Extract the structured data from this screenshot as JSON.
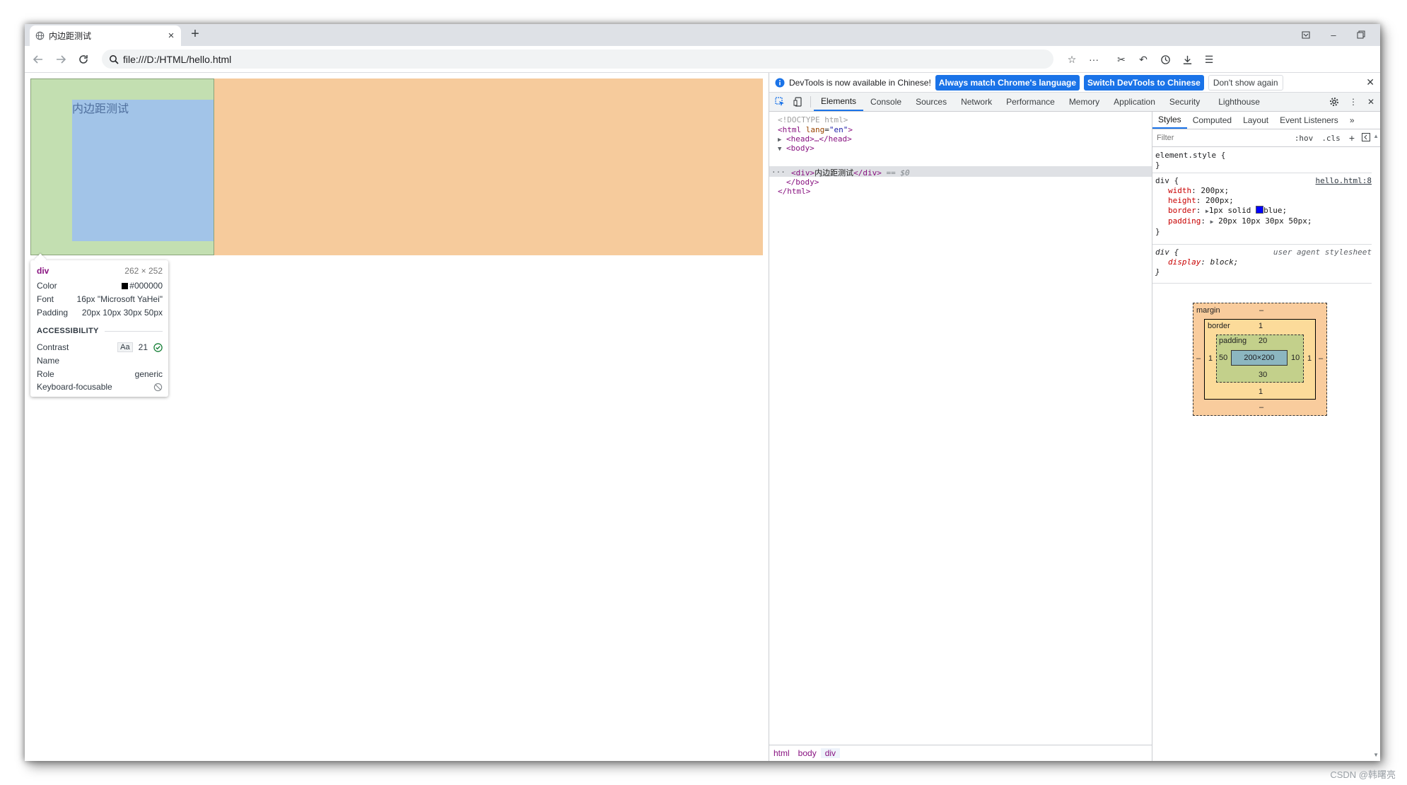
{
  "browser": {
    "tab_title": "内边距测试",
    "url": "file:///D:/HTML/hello.html"
  },
  "page": {
    "div_text": "内边距测试"
  },
  "tooltip": {
    "tag": "div",
    "size": "262 × 252",
    "color_label": "Color",
    "color_value": "#000000",
    "font_label": "Font",
    "font_value": "16px \"Microsoft YaHei\"",
    "padding_label": "Padding",
    "padding_value": "20px 10px 30px 50px",
    "accessibility_header": "ACCESSIBILITY",
    "contrast_label": "Contrast",
    "contrast_aa": "Aa",
    "contrast_value": "21",
    "name_label": "Name",
    "role_label": "Role",
    "role_value": "generic",
    "keyboard_label": "Keyboard-focusable"
  },
  "devtools": {
    "info_text": "DevTools is now available in Chinese!",
    "btn_match": "Always match Chrome's language",
    "btn_switch": "Switch DevTools to Chinese",
    "btn_dont": "Don't show again",
    "tabs": [
      "Elements",
      "Console",
      "Sources",
      "Network",
      "Performance",
      "Memory",
      "Application",
      "Security",
      "Lighthouse"
    ],
    "dom": {
      "doctype": "<!DOCTYPE html>",
      "html_open": "<html",
      "html_attr": "lang",
      "html_attr_val": "\"en\"",
      "head": "<head>…</head>",
      "body_open": "<body>",
      "div_open": "<div>",
      "div_text": "内边距测试",
      "div_close": "</div>",
      "div_eq": "== $0",
      "body_close": "</body>",
      "html_close": "</html>"
    },
    "breadcrumbs": [
      "html",
      "body",
      "div"
    ],
    "style_tabs": [
      "Styles",
      "Computed",
      "Layout",
      "Event Listeners"
    ],
    "filter_placeholder": "Filter",
    "hov": ":hov",
    "cls": ".cls",
    "rules": {
      "element_style": "element.style {",
      "close": "}",
      "div_selector": "div {",
      "div_source": "hello.html:8",
      "width_prop": "width",
      "width_val": "200px;",
      "height_prop": "height",
      "height_val": "200px;",
      "border_prop": "border",
      "border_val": "1px solid",
      "border_color": "blue;",
      "padding_prop": "padding",
      "padding_val": "20px 10px 30px 50px;",
      "ua_selector": "div {",
      "ua_source": "user agent stylesheet",
      "display_prop": "display",
      "display_val": "block;"
    },
    "box_model": {
      "margin_label": "margin",
      "margin_top": "–",
      "margin_bottom": "–",
      "margin_left": "–",
      "margin_right": "–",
      "border_label": "border",
      "border_top": "1",
      "border_bottom": "1",
      "border_left": "1",
      "border_right": "1",
      "padding_label": "padding",
      "padding_top": "20",
      "padding_bottom": "30",
      "padding_left": "50",
      "padding_right": "10",
      "content": "200×200"
    }
  },
  "colors": {
    "orange": "#f6cb9c",
    "green": "#c3dfb1",
    "blue_content": "#a2c4e8",
    "accent": "#1a73e8"
  },
  "watermark": "CSDN @韩曙亮"
}
